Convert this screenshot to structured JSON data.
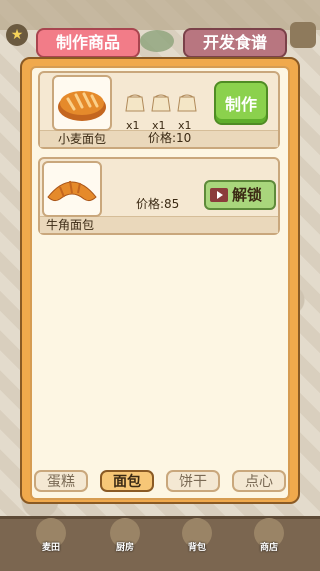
{
  "tabs": {
    "make_products": "制作商品",
    "develop_recipes": "开发食谱"
  },
  "products": [
    {
      "name": "小麦面包",
      "price": "价格:10",
      "ingredients": [
        {
          "icon": "flour-sack-icon",
          "qty": "x1"
        },
        {
          "icon": "flour-sack-icon",
          "qty": "x1"
        },
        {
          "icon": "flour-sack-icon",
          "qty": "x1"
        }
      ],
      "action_label": "制作"
    },
    {
      "name": "牛角面包",
      "price": "价格:85",
      "action_label": "解锁"
    }
  ],
  "categories": [
    {
      "label": "蛋糕",
      "active": false
    },
    {
      "label": "面包",
      "active": true
    },
    {
      "label": "饼干",
      "active": false
    },
    {
      "label": "点心",
      "active": false
    }
  ],
  "bottom_nav": [
    {
      "label": "麦田"
    },
    {
      "label": "厨房"
    },
    {
      "label": "背包"
    },
    {
      "label": "商店"
    }
  ]
}
